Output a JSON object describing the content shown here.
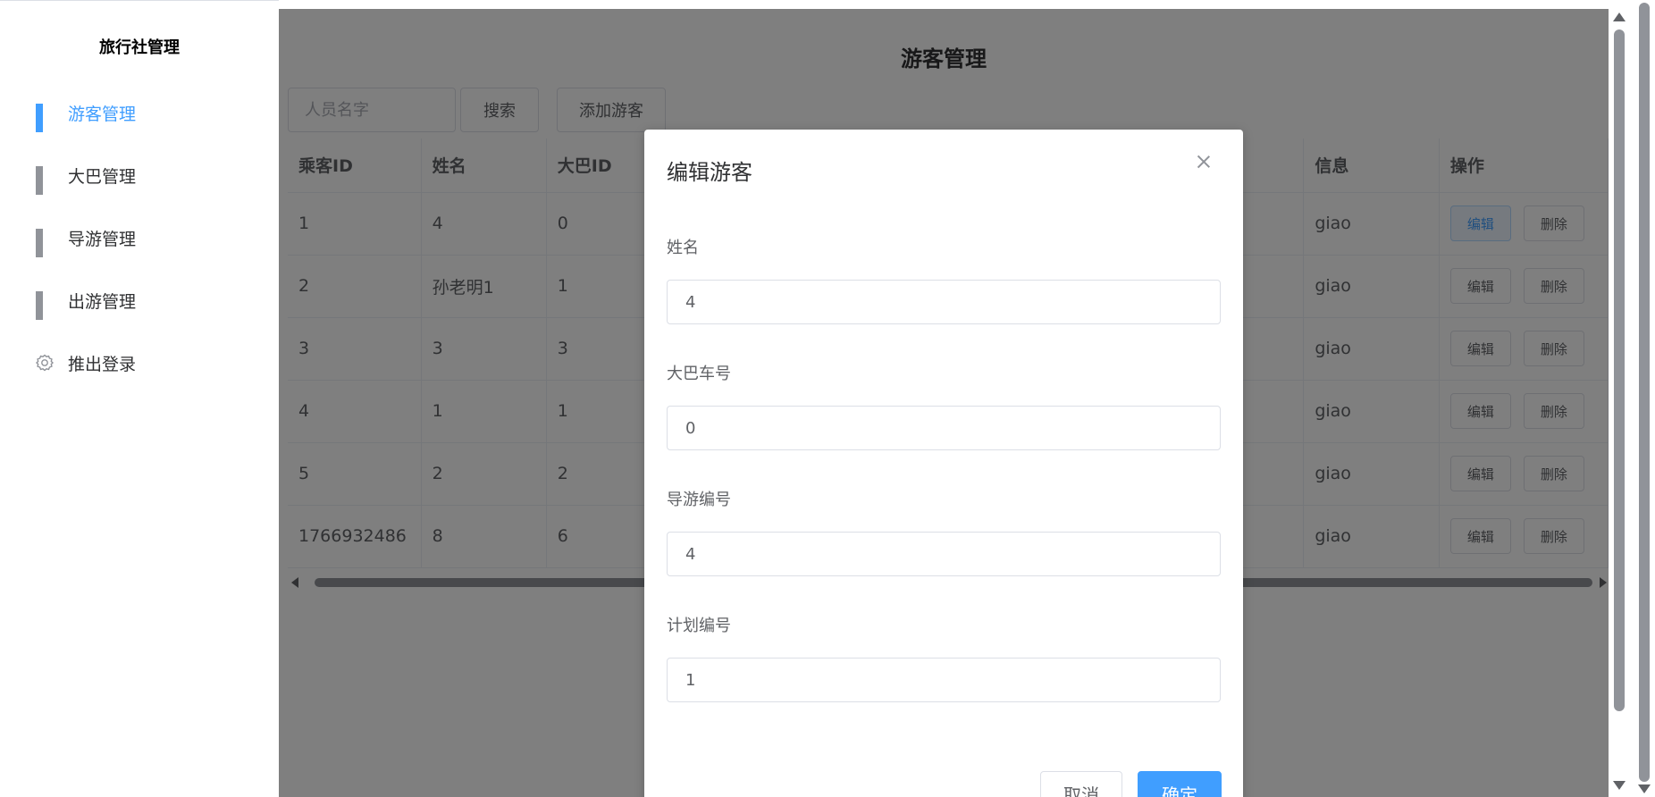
{
  "sidebar": {
    "brand": "旅行社管理",
    "items": [
      {
        "label": "游客管理",
        "icon": "grid-icon",
        "active": true
      },
      {
        "label": "大巴管理",
        "icon": "grid-icon",
        "active": false
      },
      {
        "label": "导游管理",
        "icon": "grid-icon",
        "active": false
      },
      {
        "label": "出游管理",
        "icon": "grid-icon",
        "active": false
      },
      {
        "label": "推出登录",
        "icon": "gear-icon",
        "active": false
      }
    ]
  },
  "main": {
    "title": "游客管理",
    "search_placeholder": "人员名字",
    "search_button": "搜索",
    "add_button": "添加游客",
    "table": {
      "columns": [
        "乘客ID",
        "姓名",
        "大巴ID",
        "",
        "",
        "信息",
        "操作"
      ],
      "rows": [
        {
          "id": "1",
          "name": "4",
          "bus": "0",
          "info": "giao"
        },
        {
          "id": "2",
          "name": "孙老明1",
          "bus": "1",
          "info": "giao"
        },
        {
          "id": "3",
          "name": "3",
          "bus": "3",
          "info": "giao"
        },
        {
          "id": "4",
          "name": "1",
          "bus": "1",
          "info": "giao"
        },
        {
          "id": "5",
          "name": "2",
          "bus": "2",
          "info": "giao"
        },
        {
          "id": "1766932486",
          "name": "8",
          "bus": "6",
          "info": "giao"
        }
      ],
      "edit_label": "编辑",
      "delete_label": "删除"
    }
  },
  "dialog": {
    "title": "编辑游客",
    "fields": [
      {
        "label": "姓名",
        "value": "4"
      },
      {
        "label": "大巴车号",
        "value": "0"
      },
      {
        "label": "导游编号",
        "value": "4"
      },
      {
        "label": "计划编号",
        "value": "1"
      }
    ],
    "cancel": "取消",
    "confirm": "确定"
  },
  "colors": {
    "accent": "#409eff",
    "overlay": "rgba(0,0,0,0.5)"
  }
}
